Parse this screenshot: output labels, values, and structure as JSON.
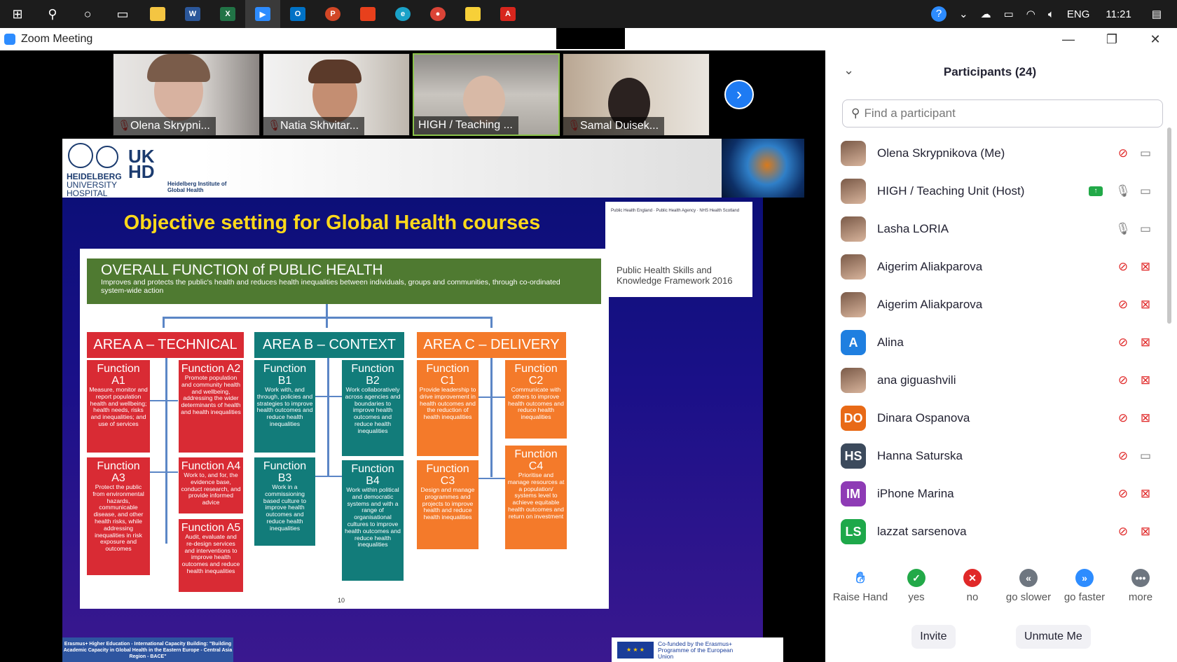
{
  "taskbar": {
    "apps": [
      "windows-start",
      "search",
      "cortana",
      "task-view",
      "file-explorer",
      "word",
      "excel",
      "zoom",
      "outlook",
      "powerpoint",
      "office",
      "edge",
      "chrome",
      "sticky-notes",
      "acrobat"
    ],
    "language": "ENG",
    "time": "11:21"
  },
  "window": {
    "title": "Zoom Meeting"
  },
  "gallery": {
    "participants": [
      {
        "name": "Olena Skrypni..."
      },
      {
        "name": "Natia Skhvitar..."
      },
      {
        "name": "HIGH / Teaching ..."
      },
      {
        "name": "Samal Duisek..."
      }
    ]
  },
  "slide": {
    "institution": {
      "line1": "HEIDELBERG",
      "line2": "UNIVERSITY",
      "line3": "HOSPITAL",
      "logo": "UK HD",
      "institute": "Heidelberg Institute of Global Health"
    },
    "title": "Objective setting for Global Health courses",
    "reference": {
      "text": "Public Health Skills and Knowledge Framework 2016",
      "logos": "Public Health England · Public Health Agency · NHS Health Scotland"
    },
    "overall": {
      "heading": "OVERALL FUNCTION of PUBLIC HEALTH",
      "sub": "Improves and protects the public's health and reduces health inequalities between individuals, groups and communities, through co-ordinated system-wide action"
    },
    "areas": {
      "a": "AREA A – TECHNICAL",
      "b": "AREA B – CONTEXT",
      "c": "AREA C – DELIVERY"
    },
    "functions": {
      "a1": {
        "t": "Function A1",
        "d": "Measure, monitor and report population health and wellbeing; health needs, risks and inequalities; and use of services"
      },
      "a2": {
        "t": "Function A2",
        "d": "Promote population and community health and wellbeing, addressing the wider determinants of health and health inequalities"
      },
      "a3": {
        "t": "Function A3",
        "d": "Protect the public from environmental hazards, communicable disease, and other health risks, while addressing inequalities in risk exposure and outcomes"
      },
      "a4": {
        "t": "Function A4",
        "d": "Work to, and for, the evidence base, conduct research, and provide informed advice"
      },
      "a5": {
        "t": "Function A5",
        "d": "Audit, evaluate and re-design services and interventions to improve health outcomes and reduce health inequalities"
      },
      "b1": {
        "t": "Function B1",
        "d": "Work with, and through, policies and strategies to improve health outcomes and reduce health inequalities"
      },
      "b2": {
        "t": "Function B2",
        "d": "Work collaboratively across agencies and boundaries to improve health outcomes and reduce health inequalities"
      },
      "b3": {
        "t": "Function B3",
        "d": "Work in a commissioning based culture to improve health outcomes and reduce health inequalities"
      },
      "b4": {
        "t": "Function B4",
        "d": "Work within political and democratic systems and with a range of organisational cultures to improve health outcomes and reduce health inequalities"
      },
      "c1": {
        "t": "Function C1",
        "d": "Provide leadership to drive improvement in health outcomes and the reduction of health inequalities"
      },
      "c2": {
        "t": "Function C2",
        "d": "Communicate with others to improve health outcomes and reduce health inequalities"
      },
      "c3": {
        "t": "Function C3",
        "d": "Design and manage programmes and projects to improve health and reduce health inequalities"
      },
      "c4": {
        "t": "Function C4",
        "d": "Prioritise and manage resources at a population/ systems level to achieve equitable health outcomes and return on investment"
      }
    },
    "page_number": "10",
    "footer_left": "Erasmus+ Higher Education - International Capacity Building: \"Building Academic Capacity in Global Health in the Eastern Europe - Central Asia Region - BACE\"",
    "footer_right": "Co-funded by the Erasmus+ Programme of the European Union"
  },
  "panel": {
    "title": "Participants (24)",
    "search_placeholder": "Find a participant",
    "participants": [
      {
        "name": "Olena Skrypnikova (Me)",
        "initials": "",
        "color": "",
        "mic": "muted",
        "video": "on"
      },
      {
        "name": "HIGH / Teaching Unit (Host)",
        "initials": "",
        "color": "",
        "mic": "on",
        "video": "on",
        "sharing": true
      },
      {
        "name": "Lasha LORIA",
        "initials": "",
        "color": "",
        "mic": "on",
        "video": "on"
      },
      {
        "name": "Aigerim Aliakparova",
        "initials": "",
        "color": "",
        "mic": "muted",
        "video": "off"
      },
      {
        "name": "Aigerim Aliakparova",
        "initials": "",
        "color": "",
        "mic": "muted",
        "video": "off"
      },
      {
        "name": "Alina",
        "initials": "A",
        "color": "#1f7fe0",
        "mic": "muted",
        "video": "off"
      },
      {
        "name": "ana giguashvili",
        "initials": "",
        "color": "",
        "mic": "muted",
        "video": "off"
      },
      {
        "name": "Dinara Ospanova",
        "initials": "DO",
        "color": "#e86a17",
        "mic": "muted",
        "video": "off"
      },
      {
        "name": "Hanna Saturska",
        "initials": "HS",
        "color": "#3c4a5c",
        "mic": "muted",
        "video": "on"
      },
      {
        "name": "iPhone Marina",
        "initials": "IM",
        "color": "#8e3bb5",
        "mic": "muted",
        "video": "off"
      },
      {
        "name": "lazzat sarsenova",
        "initials": "LS",
        "color": "#1ea84a",
        "mic": "muted",
        "video": "off"
      }
    ],
    "reactions": [
      {
        "label": "Raise Hand",
        "icon": "raise-hand-icon",
        "color": "#2d8cff"
      },
      {
        "label": "yes",
        "icon": "check-icon",
        "color": "#22a948"
      },
      {
        "label": "no",
        "icon": "x-icon",
        "color": "#e02828"
      },
      {
        "label": "go slower",
        "icon": "rewind-icon",
        "color": "#6e7680"
      },
      {
        "label": "go faster",
        "icon": "fast-forward-icon",
        "color": "#2d8cff"
      },
      {
        "label": "more",
        "icon": "more-icon",
        "color": "#6e7680"
      }
    ],
    "buttons": {
      "invite": "Invite",
      "unmute": "Unmute Me"
    }
  }
}
